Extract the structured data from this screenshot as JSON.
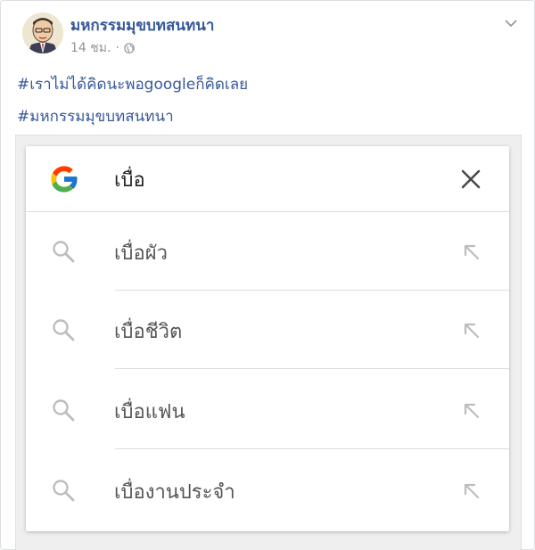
{
  "post": {
    "page_name": "มหกรรมมุขบทสนทนา",
    "time": "14 ชม.",
    "separator": "·",
    "hashtags": [
      "#เราไม่ได้คิดนะพอgoogleก็คิดเลย",
      "#มหกรรมมุขบทสนทนา"
    ]
  },
  "search": {
    "query": "เบื่อ",
    "suggestions": [
      {
        "text": "เบื่อผัว"
      },
      {
        "text": "เบื่อชีวิต"
      },
      {
        "text": "เบื่อแฟน"
      },
      {
        "text": "เบื่องานประจำ"
      }
    ]
  },
  "colors": {
    "link_blue": "#365899",
    "meta_gray": "#90949c",
    "icon_gray": "#bdbdbd"
  },
  "icons": {
    "avatar": "cartoon-man-avatar",
    "privacy": "globe-icon",
    "menu": "chevron-down-icon",
    "logo": "google-g-logo",
    "clear": "close-icon",
    "suggestion": "search-icon",
    "fill": "arrow-up-left-icon"
  }
}
